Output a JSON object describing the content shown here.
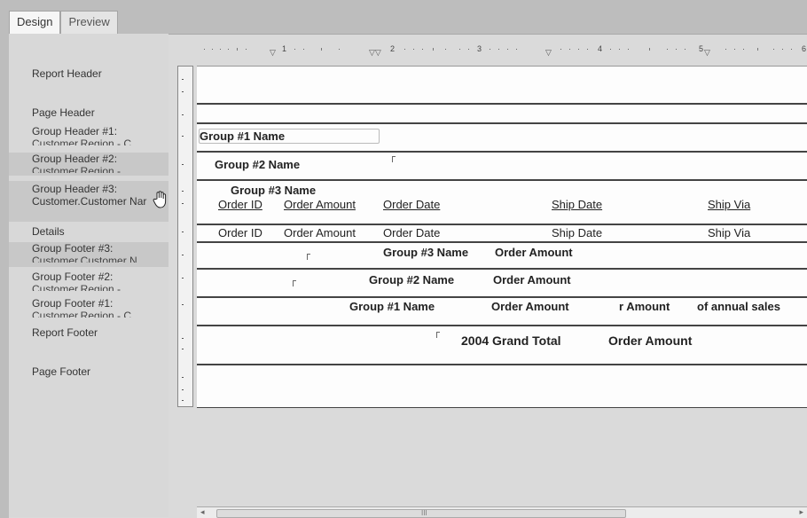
{
  "tabs": {
    "design": "Design",
    "preview": "Preview"
  },
  "sections": {
    "report_header": "Report Header",
    "page_header": "Page Header",
    "gh1": "Group Header #1:",
    "gh1_sub": "Customer.Region - C",
    "gh2": "Group Header #2:",
    "gh2_sub": "Customer.Region - ...",
    "gh3": "Group Header #3:",
    "gh3_sub": "Customer.Customer Nar",
    "details": "Details",
    "gf3": "Group Footer #3:",
    "gf3_sub": "Customer.Customer N",
    "gf2": "Group Footer #2:",
    "gf2_sub": "Customer.Region - ...",
    "gf1": "Group Footer #1:",
    "gf1_sub": "Customer.Region - C",
    "report_footer": "Report Footer",
    "page_footer": "Page Footer"
  },
  "ruler": {
    "n1": "1",
    "n2": "2",
    "n3": "3",
    "n4": "4",
    "n5": "5",
    "n6": "6"
  },
  "fields": {
    "group1_name": "Group #1 Name",
    "group2_name": "Group #2 Name",
    "group3_name": "Group #3 Name",
    "h_order_id": "Order ID",
    "h_order_amount": "Order Amount",
    "h_order_date": "Order Date",
    "h_ship_date": "Ship Date",
    "h_ship_via": "Ship Via",
    "d_order_id": "Order ID",
    "d_order_amount": "Order Amount",
    "d_order_date": "Order Date",
    "d_ship_date": "Ship Date",
    "d_ship_via": "Ship Via",
    "gf3_name": "Group #3 Name",
    "gf3_amount": "Order Amount",
    "gf2_name": "Group #2 Name",
    "gf2_amount": "Order Amount",
    "gf1_name": "Group #1 Name",
    "gf1_amount": "Order Amount",
    "gf1_amount2": "r Amount",
    "gf1_pct": "of annual sales",
    "grand_total_label": "2004 Grand Total",
    "grand_total_amount": "Order Amount"
  },
  "scrollbar": {
    "left": "◂",
    "right": "▸",
    "grip": "III"
  }
}
